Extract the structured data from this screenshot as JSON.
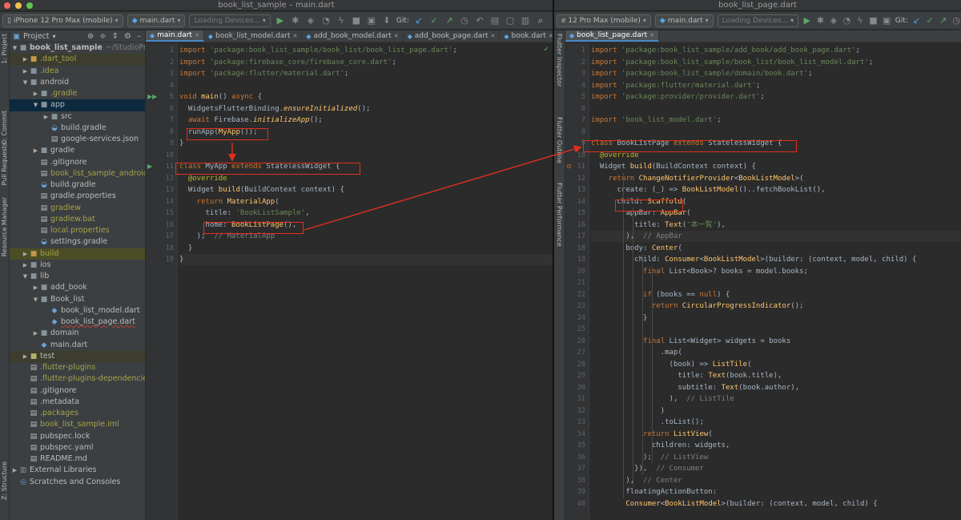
{
  "left_window": {
    "title": "book_list_sample – main.dart",
    "toolbar": {
      "device": "iPhone 12 Pro Max (mobile)",
      "run_config": "main.dart",
      "devices_loading": "Loading Devices...",
      "git_label": "Git:"
    },
    "left_tool_labels": [
      "1: Project",
      "0: Commit",
      "Pull Requests",
      "Resource Manager",
      "Z: Structure"
    ],
    "project_panel": {
      "header": "Project",
      "tree": [
        {
          "label": "book_list_sample",
          "hint": "~/StudioProjects",
          "indent": 0,
          "arrow": "down",
          "icon": "folder",
          "style": "bold"
        },
        {
          "label": ".dart_tool",
          "indent": 1,
          "arrow": "right",
          "icon": "folder-o",
          "style": "olive",
          "row": "exc"
        },
        {
          "label": ".idea",
          "indent": 1,
          "arrow": "right",
          "icon": "folder",
          "style": "olive"
        },
        {
          "label": "android",
          "indent": 1,
          "arrow": "down",
          "icon": "folder"
        },
        {
          "label": ".gradle",
          "indent": 2,
          "arrow": "right",
          "icon": "folder",
          "style": "olive"
        },
        {
          "label": "app",
          "indent": 2,
          "arrow": "down",
          "icon": "folder",
          "row": "sel2"
        },
        {
          "label": "src",
          "indent": 3,
          "arrow": "right",
          "icon": "folder"
        },
        {
          "label": "build.gradle",
          "indent": 3,
          "arrow": "",
          "icon": "gradle"
        },
        {
          "label": "google-services.json",
          "indent": 3,
          "arrow": "",
          "icon": "file"
        },
        {
          "label": "gradle",
          "indent": 2,
          "arrow": "right",
          "icon": "folder"
        },
        {
          "label": ".gitignore",
          "indent": 2,
          "arrow": "",
          "icon": "file"
        },
        {
          "label": "book_list_sample_android.i",
          "indent": 2,
          "arrow": "",
          "icon": "file",
          "style": "olive"
        },
        {
          "label": "build.gradle",
          "indent": 2,
          "arrow": "",
          "icon": "gradle"
        },
        {
          "label": "gradle.properties",
          "indent": 2,
          "arrow": "",
          "icon": "file"
        },
        {
          "label": "gradlew",
          "indent": 2,
          "arrow": "",
          "icon": "file",
          "style": "olive"
        },
        {
          "label": "gradlew.bat",
          "indent": 2,
          "arrow": "",
          "icon": "file",
          "style": "olive"
        },
        {
          "label": "local.properties",
          "indent": 2,
          "arrow": "",
          "icon": "file",
          "style": "olive"
        },
        {
          "label": "settings.gradle",
          "indent": 2,
          "arrow": "",
          "icon": "gradle"
        },
        {
          "label": "build",
          "indent": 1,
          "arrow": "right",
          "icon": "folder-o",
          "style": "olive",
          "row": "sel"
        },
        {
          "label": "ios",
          "indent": 1,
          "arrow": "right",
          "icon": "folder"
        },
        {
          "label": "lib",
          "indent": 1,
          "arrow": "down",
          "icon": "folder"
        },
        {
          "label": "add_book",
          "indent": 2,
          "arrow": "right",
          "icon": "folder"
        },
        {
          "label": "Book_list",
          "indent": 2,
          "arrow": "down",
          "icon": "folder"
        },
        {
          "label": "book_list_model.dart",
          "indent": 3,
          "arrow": "",
          "icon": "dart"
        },
        {
          "label": "book_list_page.dart",
          "indent": 3,
          "arrow": "",
          "icon": "dart",
          "style": "underline"
        },
        {
          "label": "domain",
          "indent": 2,
          "arrow": "right",
          "icon": "folder"
        },
        {
          "label": "main.dart",
          "indent": 2,
          "arrow": "",
          "icon": "dart"
        },
        {
          "label": "test",
          "indent": 1,
          "arrow": "right",
          "icon": "folder-g",
          "row": "exc"
        },
        {
          "label": ".flutter-plugins",
          "indent": 1,
          "arrow": "",
          "icon": "file",
          "style": "olive"
        },
        {
          "label": ".flutter-plugins-dependencies",
          "indent": 1,
          "arrow": "",
          "icon": "file",
          "style": "olive"
        },
        {
          "label": ".gitignore",
          "indent": 1,
          "arrow": "",
          "icon": "file"
        },
        {
          "label": ".metadata",
          "indent": 1,
          "arrow": "",
          "icon": "file"
        },
        {
          "label": ".packages",
          "indent": 1,
          "arrow": "",
          "icon": "file",
          "style": "olive"
        },
        {
          "label": "book_list_sample.iml",
          "indent": 1,
          "arrow": "",
          "icon": "file",
          "style": "olive"
        },
        {
          "label": "pubspec.lock",
          "indent": 1,
          "arrow": "",
          "icon": "file"
        },
        {
          "label": "pubspec.yaml",
          "indent": 1,
          "arrow": "",
          "icon": "file"
        },
        {
          "label": "README.md",
          "indent": 1,
          "arrow": "",
          "icon": "file"
        },
        {
          "label": "External Libraries",
          "indent": 0,
          "arrow": "right",
          "icon": "lib"
        },
        {
          "label": "Scratches and Consoles",
          "indent": 0,
          "arrow": "",
          "icon": "scratch"
        }
      ]
    },
    "tabs": [
      "main.dart",
      "book_list_model.dart",
      "add_book_model.dart",
      "add_book_page.dart",
      "book.dart"
    ],
    "code_lines": [
      [
        [
          "k",
          "import "
        ],
        [
          "s",
          "'package:book_list_sample/book_list/book_list_page.dart'"
        ],
        [
          "t",
          ";"
        ]
      ],
      [
        [
          "k",
          "import "
        ],
        [
          "s",
          "'package:firebase_core/firebase_core.dart'"
        ],
        [
          "t",
          ";"
        ]
      ],
      [
        [
          "k",
          "import "
        ],
        [
          "s",
          "'package:flutter/material.dart'"
        ],
        [
          "t",
          ";"
        ]
      ],
      [],
      [
        [
          "k",
          "void "
        ],
        [
          "f",
          "main"
        ],
        [
          "t",
          "() "
        ],
        [
          "k",
          "async "
        ],
        [
          "t",
          "{"
        ]
      ],
      [
        [
          "t",
          "  WidgetsFlutterBinding."
        ],
        [
          "fi",
          "ensureInitialized"
        ],
        [
          "t",
          "();"
        ]
      ],
      [
        [
          "k",
          "  await "
        ],
        [
          "t",
          "Firebase."
        ],
        [
          "fi",
          "initializeApp"
        ],
        [
          "t",
          "();"
        ]
      ],
      [
        [
          "t",
          "  runApp("
        ],
        [
          "f",
          "MyApp"
        ],
        [
          "t",
          "());"
        ]
      ],
      [
        [
          "t",
          "}"
        ]
      ],
      [],
      [
        [
          "k",
          "class "
        ],
        [
          "t",
          "MyApp "
        ],
        [
          "k",
          "extends "
        ],
        [
          "t",
          "StatelessWidget {"
        ]
      ],
      [
        [
          "an",
          "  @override"
        ]
      ],
      [
        [
          "t",
          "  Widget "
        ],
        [
          "f",
          "build"
        ],
        [
          "t",
          "(BuildContext context) {"
        ]
      ],
      [
        [
          "k",
          "    return "
        ],
        [
          "f",
          "MaterialApp"
        ],
        [
          "t",
          "("
        ]
      ],
      [
        [
          "t",
          "      title: "
        ],
        [
          "s",
          "'BookListSample'"
        ],
        [
          "t",
          ","
        ]
      ],
      [
        [
          "t",
          "      home: "
        ],
        [
          "f",
          "BookListPage"
        ],
        [
          "t",
          "(),"
        ]
      ],
      [
        [
          "t",
          "    );  "
        ],
        [
          "c",
          "// MaterialApp"
        ]
      ],
      [
        [
          "t",
          "  }"
        ]
      ],
      [
        [
          "t",
          "}"
        ]
      ]
    ]
  },
  "right_window": {
    "title": "book_list_page.dart",
    "toolbar": {
      "device": "e 12 Pro Max (mobile)",
      "run_config": "main.dart",
      "devices_loading": "Loading Devices...",
      "git_label": "Git:"
    },
    "side_labels": [
      "Flutter Inspector",
      "Flutter Outline",
      "Flutter Performance"
    ],
    "tabs": [
      "book_list_page.dart"
    ],
    "line_numbers": [
      "1",
      "2",
      "3",
      "4",
      "5",
      "6",
      "7",
      "8",
      "9",
      "10",
      "11",
      "12",
      "13",
      "14",
      "15",
      "16",
      "17",
      "18",
      "19",
      "20",
      "21",
      "22",
      "23",
      "24",
      "25",
      "26",
      "27",
      "28",
      "29",
      "30",
      "31",
      "32",
      "33",
      "34",
      "35",
      "36",
      "37",
      "38",
      "39",
      "40"
    ],
    "code_lines": [
      [
        [
          "k",
          "import "
        ],
        [
          "s",
          "'package:book_list_sample/add_book/add_book_page.dart'"
        ],
        [
          "t",
          ";"
        ]
      ],
      [
        [
          "k",
          "import "
        ],
        [
          "s",
          "'package:book_list_sample/book_list/book_list_model.dart'"
        ],
        [
          "t",
          ";"
        ]
      ],
      [
        [
          "k",
          "import "
        ],
        [
          "s",
          "'package:book_list_sample/domain/book.dart'"
        ],
        [
          "t",
          ";"
        ]
      ],
      [
        [
          "k",
          "import "
        ],
        [
          "s",
          "'package:flutter/material.dart'"
        ],
        [
          "t",
          ";"
        ]
      ],
      [
        [
          "k",
          "import "
        ],
        [
          "s",
          "'package:provider/provider.dart'"
        ],
        [
          "t",
          ";"
        ]
      ],
      [],
      [
        [
          "k",
          "import "
        ],
        [
          "s",
          "'book_list_model.dart'"
        ],
        [
          "t",
          ";"
        ]
      ],
      [],
      [
        [
          "k",
          "class "
        ],
        [
          "t",
          "BookListPage "
        ],
        [
          "k",
          "extends "
        ],
        [
          "t",
          "StatelessWidget {"
        ]
      ],
      [
        [
          "an",
          "  @override"
        ]
      ],
      [
        [
          "t",
          "  Widget "
        ],
        [
          "f",
          "build"
        ],
        [
          "t",
          "(BuildContext context) {"
        ]
      ],
      [
        [
          "k",
          "    return "
        ],
        [
          "f",
          "ChangeNotifierProvider"
        ],
        [
          "t",
          "<"
        ],
        [
          "f",
          "BookListModel"
        ],
        [
          "t",
          ">("
        ]
      ],
      [
        [
          "t",
          "      create: (_) => "
        ],
        [
          "f",
          "BookListModel"
        ],
        [
          "t",
          "()..fetchBookList(),"
        ]
      ],
      [
        [
          "t",
          "      child: "
        ],
        [
          "f",
          "Scaffold"
        ],
        [
          "t",
          "("
        ]
      ],
      [
        [
          "t",
          "        appBar: "
        ],
        [
          "f",
          "AppBar"
        ],
        [
          "t",
          "("
        ]
      ],
      [
        [
          "t",
          "          title: "
        ],
        [
          "f",
          "Text"
        ],
        [
          "t",
          "("
        ],
        [
          "s",
          "'本一覧'"
        ],
        [
          "t",
          "),"
        ]
      ],
      [
        [
          "t",
          "        ),  "
        ],
        [
          "c",
          "// AppBar"
        ]
      ],
      [
        [
          "t",
          "        body: "
        ],
        [
          "f",
          "Center"
        ],
        [
          "t",
          "("
        ]
      ],
      [
        [
          "t",
          "          child: "
        ],
        [
          "f",
          "Consumer"
        ],
        [
          "t",
          "<"
        ],
        [
          "f",
          "BookListModel"
        ],
        [
          "t",
          ">(builder: (context, model, child) {"
        ]
      ],
      [
        [
          "k",
          "            final "
        ],
        [
          "t",
          "List<Book>? books = model.books;"
        ]
      ],
      [],
      [
        [
          "k",
          "            if "
        ],
        [
          "t",
          "(books == "
        ],
        [
          "k",
          "null"
        ],
        [
          "t",
          ") {"
        ]
      ],
      [
        [
          "k",
          "              return "
        ],
        [
          "f",
          "CircularProgressIndicator"
        ],
        [
          "t",
          "();"
        ]
      ],
      [
        [
          "t",
          "            }"
        ]
      ],
      [],
      [
        [
          "k",
          "            final "
        ],
        [
          "t",
          "List<Widget> widgets = books"
        ]
      ],
      [
        [
          "t",
          "                .map("
        ]
      ],
      [
        [
          "t",
          "                  (book) => "
        ],
        [
          "f",
          "ListTile"
        ],
        [
          "t",
          "("
        ]
      ],
      [
        [
          "t",
          "                    title: "
        ],
        [
          "f",
          "Text"
        ],
        [
          "t",
          "(book.title),"
        ]
      ],
      [
        [
          "t",
          "                    subtitle: "
        ],
        [
          "f",
          "Text"
        ],
        [
          "t",
          "(book.author),"
        ]
      ],
      [
        [
          "t",
          "                  ),  "
        ],
        [
          "c",
          "// ListTile"
        ]
      ],
      [
        [
          "t",
          "                )"
        ]
      ],
      [
        [
          "t",
          "                .toList();"
        ]
      ],
      [
        [
          "k",
          "            return "
        ],
        [
          "f",
          "ListView"
        ],
        [
          "t",
          "("
        ]
      ],
      [
        [
          "t",
          "              children: widgets,"
        ]
      ],
      [
        [
          "t",
          "            );  "
        ],
        [
          "c",
          "// ListView"
        ]
      ],
      [
        [
          "t",
          "          }),  "
        ],
        [
          "c",
          "// Consumer"
        ]
      ],
      [
        [
          "t",
          "        ),  "
        ],
        [
          "c",
          "// Center"
        ]
      ],
      [
        [
          "t",
          "        floatingActionButton:"
        ]
      ],
      [
        [
          "t",
          "        "
        ],
        [
          "f",
          "Consumer"
        ],
        [
          "t",
          "<"
        ],
        [
          "f",
          "BookListModel"
        ],
        [
          "t",
          ">(builder: (context, model, child) {"
        ]
      ]
    ]
  },
  "colors": {
    "highlight_box": "#e0301e",
    "keyword": "#cc7832",
    "string": "#6a8759",
    "function": "#ffc66d",
    "comment": "#808080"
  }
}
